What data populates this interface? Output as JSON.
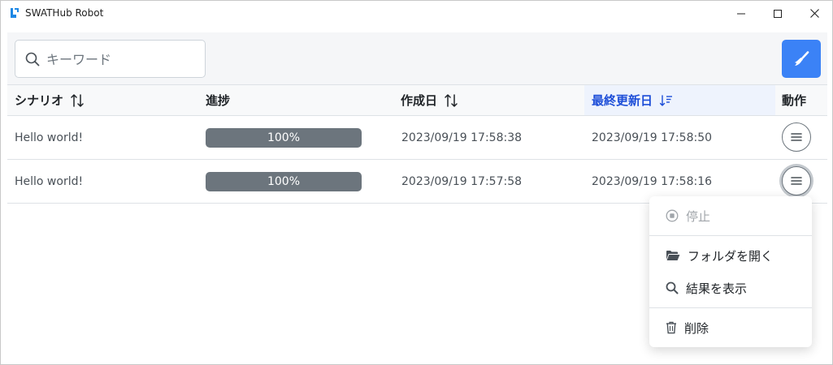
{
  "app": {
    "title": "SWATHub Robot"
  },
  "window_controls": {
    "minimize": "minimize",
    "maximize": "maximize",
    "close": "close"
  },
  "search": {
    "placeholder": "キーワード",
    "value": ""
  },
  "toolbar": {
    "clean_icon": "broom-icon"
  },
  "table": {
    "columns": [
      {
        "label": "シナリオ",
        "sort": "none"
      },
      {
        "label": "進捗",
        "sort": null
      },
      {
        "label": "作成日",
        "sort": "none"
      },
      {
        "label": "最終更新日",
        "sort": "descending"
      },
      {
        "label": "動作",
        "sort": null
      }
    ],
    "rows": [
      {
        "scenario": "Hello world!",
        "progress": "100%",
        "progress_value": 1.0,
        "created": "2023/09/19 17:58:38",
        "updated": "2023/09/19 17:58:50"
      },
      {
        "scenario": "Hello world!",
        "progress": "100%",
        "progress_value": 1.0,
        "created": "2023/09/19 17:57:58",
        "updated": "2023/09/19 17:58:16"
      }
    ]
  },
  "menu": {
    "items": [
      {
        "label": "停止",
        "icon": "stop-circle-icon",
        "disabled": true
      },
      {
        "label": "フォルダを開く",
        "icon": "folder-open-icon",
        "disabled": false
      },
      {
        "label": "結果を表示",
        "icon": "search-icon",
        "disabled": false
      },
      {
        "label": "削除",
        "icon": "trash-icon",
        "disabled": false
      }
    ]
  },
  "colors": {
    "accent": "#3b82f6",
    "active_sort": "#1d4ed8",
    "progress_bar": "#6c757d",
    "header_bg": "#f8f9fa"
  }
}
